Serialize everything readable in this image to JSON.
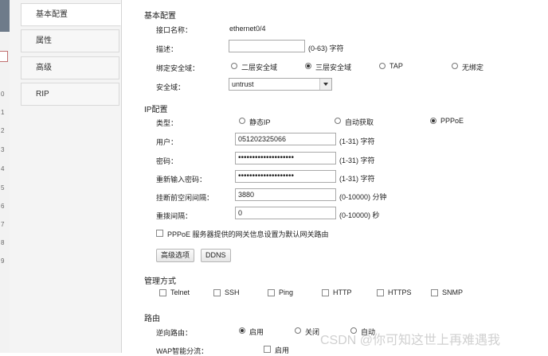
{
  "gutter": {
    "line_numbers": [
      "0",
      "1",
      "2",
      "3",
      "4",
      "5",
      "6",
      "7",
      "8",
      "9"
    ]
  },
  "sidebar": {
    "items": [
      {
        "label": "基本配置",
        "active": true
      },
      {
        "label": "属性",
        "active": false
      },
      {
        "label": "高级",
        "active": false
      },
      {
        "label": "RIP",
        "active": false
      }
    ]
  },
  "basic": {
    "section_title": "基本配置",
    "interface_label": "接口名称：",
    "interface_value": "ethernet0/4",
    "desc_label": "描述：",
    "desc_value": "",
    "desc_hint": "(0-63) 字符",
    "zone_binding_label": "绑定安全域：",
    "zone_binding_options": [
      {
        "label": "二层安全域",
        "selected": false
      },
      {
        "label": "三层安全域",
        "selected": true
      },
      {
        "label": "TAP",
        "selected": false
      },
      {
        "label": "无绑定",
        "selected": false
      }
    ],
    "zone_label": "安全域：",
    "zone_value": "untrust"
  },
  "ip": {
    "section_title": "IP配置",
    "type_label": "类型：",
    "type_options": [
      {
        "label": "静态IP",
        "selected": false
      },
      {
        "label": "自动获取",
        "selected": false
      },
      {
        "label": "PPPoE",
        "selected": true
      }
    ],
    "user_label": "用户：",
    "user_value": "051202325066",
    "user_hint": "(1-31) 字符",
    "pwd_label": "密码：",
    "pwd_value": "••••••••••••••••••••",
    "pwd_hint": "(1-31) 字符",
    "pwd2_label": "重新输入密码：",
    "pwd2_value": "••••••••••••••••••••",
    "pwd2_hint": "(1-31) 字符",
    "idle_label": "挂断前空闲间隔：",
    "idle_value": "3880",
    "idle_hint": "(0-10000) 分钟",
    "redial_label": "重拨间隔：",
    "redial_value": "0",
    "redial_hint": "(0-10000) 秒",
    "default_route_label": "PPPoE 服务器提供的网关信息设置为默认网关路由",
    "advanced_btn": "高级选项",
    "ddns_btn": "DDNS"
  },
  "mgmt": {
    "section_title": "管理方式",
    "options": [
      "Telnet",
      "SSH",
      "Ping",
      "HTTP",
      "HTTPS",
      "SNMP"
    ]
  },
  "route": {
    "section_title": "路由",
    "reverse_label": "逆向路由：",
    "reverse_options": [
      {
        "label": "启用",
        "selected": true
      },
      {
        "label": "关闭",
        "selected": false
      },
      {
        "label": "自动",
        "selected": false
      }
    ],
    "wap_label": "WAP智能分流：",
    "wap_option": "启用"
  },
  "watermark": "CSDN @你可知这世上再难遇我"
}
